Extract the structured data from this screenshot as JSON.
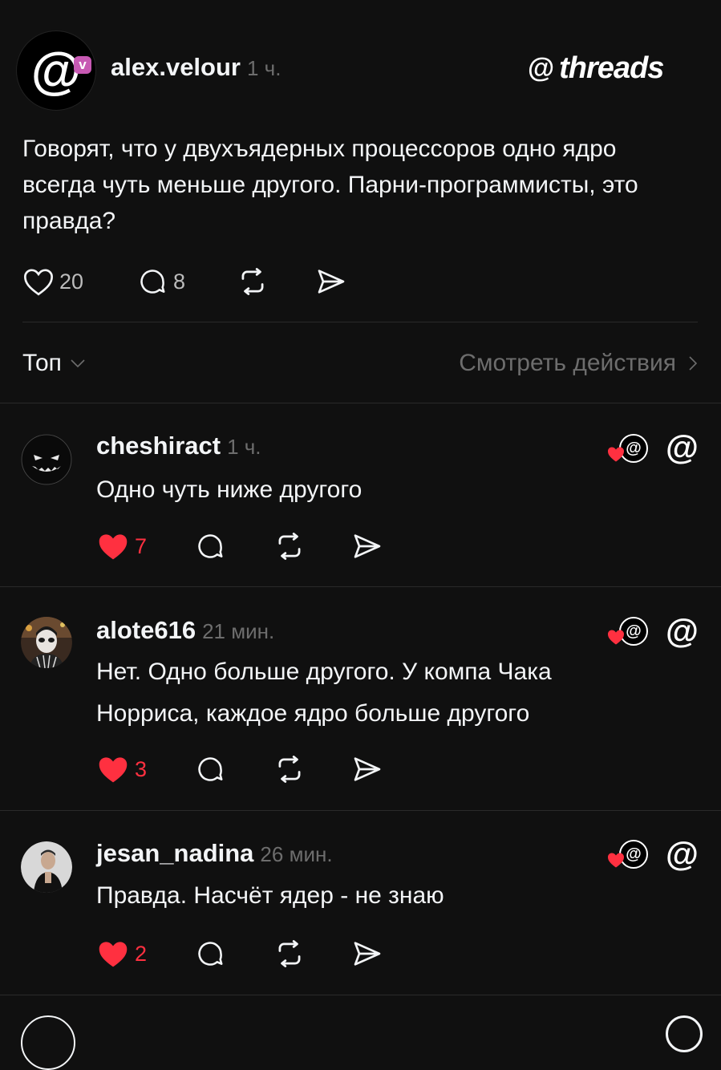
{
  "post": {
    "avatar_glyph": "@",
    "badge_letter": "v",
    "username": "alex.velour",
    "time": "1 ч.",
    "text": "Говорят, что у двухъядерных процессоров одно ядро всегда чуть меньше другого. Парни-программисты, это правда?",
    "likes": "20",
    "comments": "8"
  },
  "brand": {
    "glyph": "@",
    "word": "threads"
  },
  "sort": {
    "label": "Топ",
    "see_actions": "Смотреть действия"
  },
  "colors": {
    "accent_like": "#ff3040",
    "background": "#101010",
    "muted": "#6d6d6d"
  },
  "replies": [
    {
      "username": "cheshiract",
      "time": "1 ч.",
      "text": "Одно чуть ниже другого",
      "likes": "7"
    },
    {
      "username": "alote616",
      "time": "21 мин.",
      "text_line1": "Нет. Одно больше другого. У компа Чака",
      "text_line2": "Норриса, каждое ядро больше другого",
      "likes": "3"
    },
    {
      "username": "jesan_nadina",
      "time": "26 мин.",
      "text": "Правда. Насчёт ядер - не знаю",
      "likes": "2"
    }
  ],
  "icons": {
    "heart": "heart-icon",
    "comment": "comment-icon",
    "repost": "repost-icon",
    "share": "share-icon",
    "chevron_down": "chevron-down-icon",
    "chevron_right": "chevron-right-icon",
    "threads_logo": "threads-logo-icon"
  }
}
